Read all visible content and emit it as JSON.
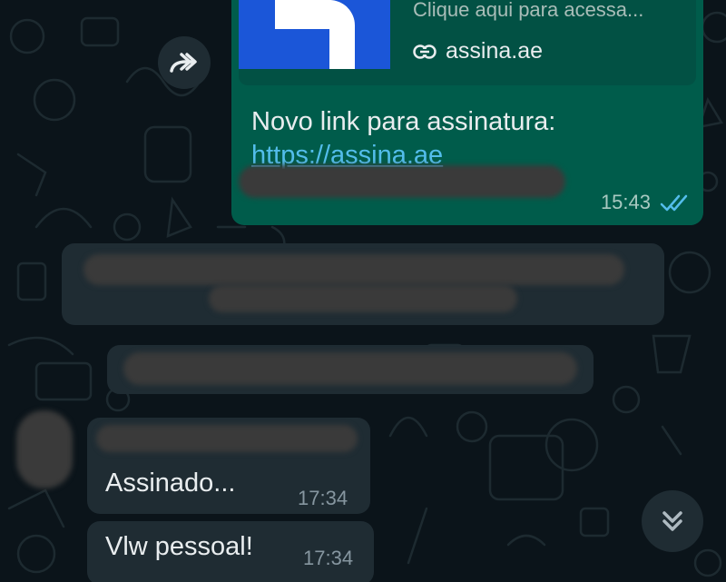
{
  "chat": {
    "outgoing": {
      "link_preview": {
        "description": "Clique aqui para acessa...",
        "domain": "assina.ae",
        "thumb_color": "#1b56d8"
      },
      "text": "Novo link para assinatura:",
      "link": "https://assina.ae",
      "time": "15:43",
      "status": "read-double-check"
    },
    "incoming": [
      {
        "text": "Assinado...",
        "time": "17:34"
      },
      {
        "text": "Vlw pessoal!",
        "time": "17:34"
      }
    ]
  },
  "colors": {
    "background": "#0b141a",
    "outgoing_bubble": "#005c4b",
    "incoming_bubble": "#1f2c33",
    "link": "#53bdeb",
    "read_ticks": "#53bdeb"
  },
  "icons": [
    "forward-icon",
    "link-icon",
    "double-check-icon",
    "chevron-double-down-icon"
  ]
}
